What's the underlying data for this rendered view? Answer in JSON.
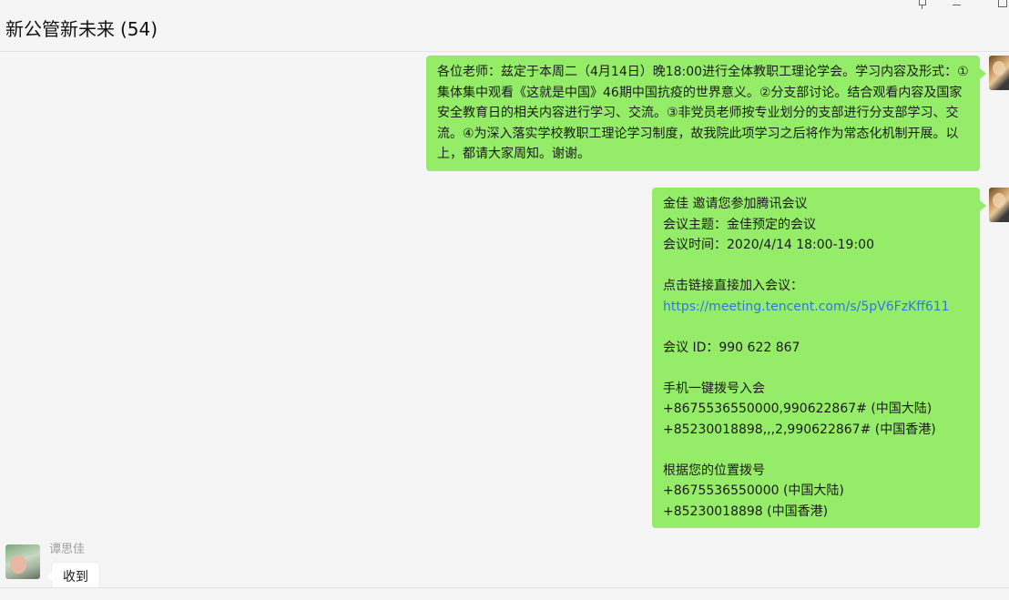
{
  "header": {
    "title": "新公管新未来",
    "member_count": "(54)"
  },
  "window_controls": {
    "pin_icon": "pin-icon",
    "minimize_icon": "minimize-icon",
    "maximize_icon": "maximize-icon"
  },
  "messages": [
    {
      "direction": "outgoing",
      "text": "各位老师：兹定于本周二（4月14日）晚18:00进行全体教职工理论学会。学习内容及形式：①集体集中观看《这就是中国》46期中国抗疫的世界意义。②分支部讨论。结合观看内容及国家安全教育日的相关内容进行学习、交流。③非党员老师按专业划分的支部进行分支部学习、交流。④为深入落实学校教职工理论学习制度，故我院此项学习之后将作为常态化机制开展。以上，都请大家周知。谢谢。"
    },
    {
      "direction": "outgoing",
      "lines": [
        "金佳 邀请您参加腾讯会议",
        "会议主题：金佳预定的会议",
        "会议时间：2020/4/14 18:00-19:00",
        "",
        "点击链接直接加入会议：",
        "https://meeting.tencent.com/s/5pV6FzKff611",
        "",
        "会议 ID：990 622 867",
        "",
        "手机一键拨号入会",
        "+8675536550000,990622867# (中国大陆)",
        "+85230018898,,,2,990622867# (中国香港)",
        "",
        "根据您的位置拨号",
        "+8675536550000 (中国大陆)",
        "+85230018898 (中国香港)"
      ],
      "link_line_index": 5
    },
    {
      "direction": "incoming",
      "sender": "谭思佳",
      "text": "收到"
    }
  ],
  "colors": {
    "outgoing_bubble": "#95ec69",
    "incoming_bubble": "#ffffff",
    "link": "#2a7ae2",
    "background": "#f5f5f5"
  }
}
